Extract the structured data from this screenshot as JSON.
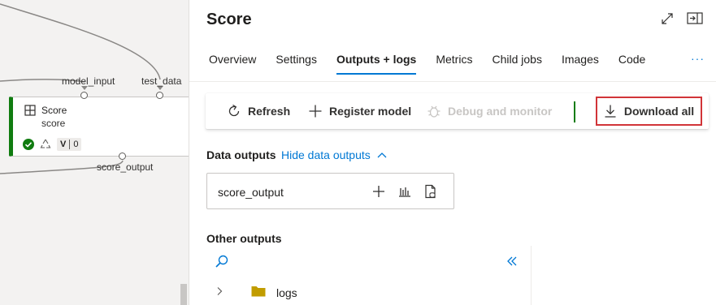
{
  "canvas": {
    "ports": {
      "model_input": "model_input",
      "test_data": "test_data",
      "score_output": "score_output"
    },
    "node": {
      "title": "Score",
      "subtitle": "score",
      "version_label": "V",
      "version_number": "0",
      "status": "completed",
      "accent_color": "#107c10"
    }
  },
  "panel": {
    "title": "Score",
    "tabs": [
      {
        "label": "Overview",
        "active": false
      },
      {
        "label": "Settings",
        "active": false
      },
      {
        "label": "Outputs + logs",
        "active": true
      },
      {
        "label": "Metrics",
        "active": false
      },
      {
        "label": "Child jobs",
        "active": false
      },
      {
        "label": "Images",
        "active": false
      },
      {
        "label": "Code",
        "active": false
      }
    ],
    "more_label": "···"
  },
  "toolbar": {
    "refresh_label": "Refresh",
    "register_label": "Register model",
    "debug_label": "Debug and monitor",
    "download_label": "Download all",
    "highlight_color": "#d13438"
  },
  "data_outputs": {
    "heading": "Data outputs",
    "toggle_label": "Hide data outputs",
    "items": [
      {
        "name": "score_output"
      }
    ]
  },
  "other_outputs": {
    "heading": "Other outputs",
    "tree": [
      {
        "name": "logs",
        "type": "folder",
        "expanded": false
      }
    ]
  },
  "colors": {
    "link": "#0078d4",
    "success": "#107c10",
    "folder": "#c19c00"
  }
}
